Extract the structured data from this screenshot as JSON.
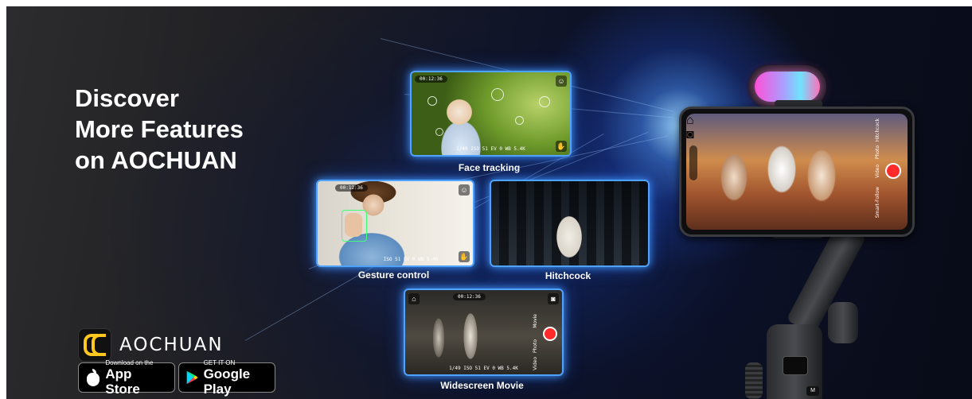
{
  "headline": {
    "line1": "Discover",
    "line2": "More Features",
    "line3": "on AOCHUAN"
  },
  "features": [
    {
      "caption": "Face tracking",
      "status_time": "00:12:36",
      "bottom_readout": "1/49  ISO 51  EV 0  WB 5.4K"
    },
    {
      "caption": "Gesture control",
      "status_time": "00:12:36",
      "bottom_readout": "ISO 51  EV 0  WB 5.4K"
    },
    {
      "caption": "Hitchcock"
    },
    {
      "caption": "Widescreen Movie",
      "status_time": "00:12:36",
      "bottom_readout": "1/49  ISO 51  EV 0  WB 5.4K",
      "side_labels": [
        "Movie",
        "Photo",
        "Video"
      ]
    }
  ],
  "phone": {
    "side_labels": [
      "Smart-Follow",
      "Video",
      "Photo",
      "Hitchcock"
    ]
  },
  "brand": {
    "name": "AOCHUAN"
  },
  "stores": {
    "app_store": {
      "small": "Download on the",
      "big": "App Store"
    },
    "google_play": {
      "small": "GET IT ON",
      "big": "Google Play"
    }
  }
}
